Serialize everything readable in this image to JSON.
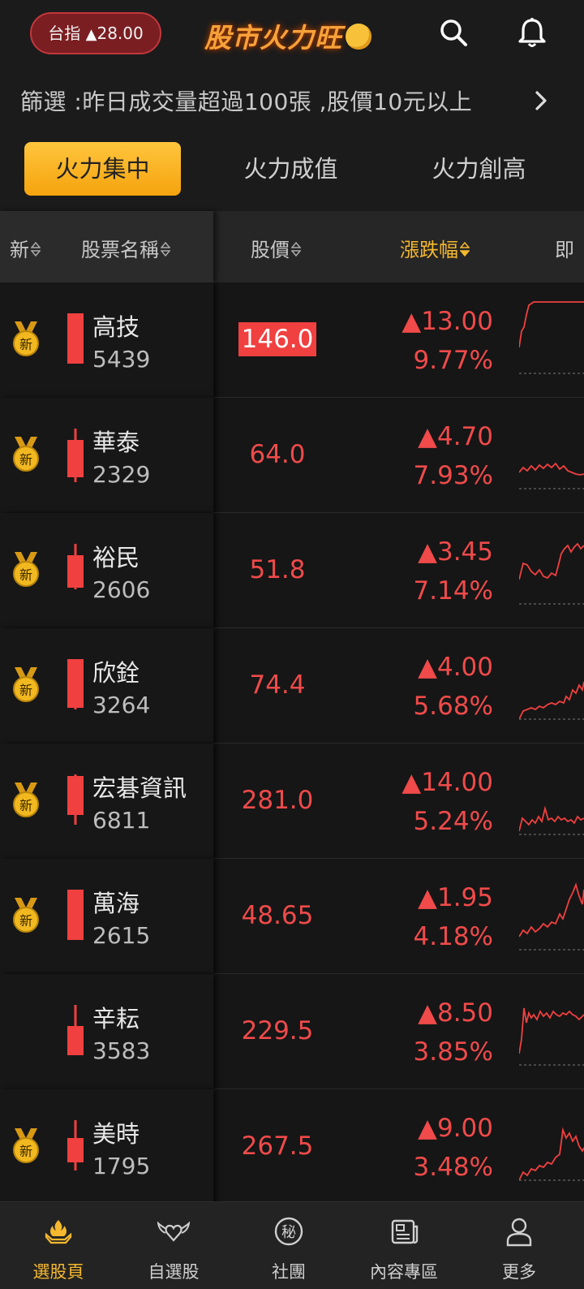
{
  "header": {
    "index_label": "台指",
    "index_arrow": "▲",
    "index_value": "28.00",
    "logo_text": "股市火力旺",
    "icons": [
      "search-icon",
      "bell-icon"
    ]
  },
  "filter": {
    "text": "篩選 :昨日成交量超過100張 ,股價10元以上",
    "icon": "chevron-right-icon"
  },
  "tabs": [
    {
      "label": "火力集中",
      "active": true
    },
    {
      "label": "火力成值",
      "active": false
    },
    {
      "label": "火力創高",
      "active": false
    }
  ],
  "columns": {
    "new": "新",
    "name": "股票名稱",
    "price": "股價",
    "change": "漲跌幅",
    "realtime": "即"
  },
  "rows": [
    {
      "new": true,
      "name": "高技",
      "code": "5439",
      "price": "146.0",
      "highlight": true,
      "change": "▲13.00",
      "pct": "9.77%"
    },
    {
      "new": true,
      "name": "華泰",
      "code": "2329",
      "price": "64.0",
      "highlight": false,
      "change": "▲4.70",
      "pct": "7.93%"
    },
    {
      "new": true,
      "name": "裕民",
      "code": "2606",
      "price": "51.8",
      "highlight": false,
      "change": "▲3.45",
      "pct": "7.14%"
    },
    {
      "new": true,
      "name": "欣銓",
      "code": "3264",
      "price": "74.4",
      "highlight": false,
      "change": "▲4.00",
      "pct": "5.68%"
    },
    {
      "new": true,
      "name": "宏碁資訊",
      "code": "6811",
      "price": "281.0",
      "highlight": false,
      "change": "▲14.00",
      "pct": "5.24%"
    },
    {
      "new": true,
      "name": "萬海",
      "code": "2615",
      "price": "48.65",
      "highlight": false,
      "change": "▲1.95",
      "pct": "4.18%"
    },
    {
      "new": false,
      "name": "辛耘",
      "code": "3583",
      "price": "229.5",
      "highlight": false,
      "change": "▲8.50",
      "pct": "3.85%"
    },
    {
      "new": true,
      "name": "美時",
      "code": "1795",
      "price": "267.5",
      "highlight": false,
      "change": "▲9.00",
      "pct": "3.48%"
    }
  ],
  "new_badge": "新",
  "colors": {
    "up": "#f04a4a",
    "accent": "#f5b82e",
    "bg": "#161616"
  },
  "bottom_nav": [
    {
      "label": "選股頁",
      "icon": "fire-hand-icon",
      "active": true
    },
    {
      "label": "自選股",
      "icon": "winged-heart-icon",
      "active": false
    },
    {
      "label": "社團",
      "icon": "secret-badge-icon",
      "active": false,
      "glyph": "秘"
    },
    {
      "label": "內容專區",
      "icon": "newspaper-icon",
      "active": false
    },
    {
      "label": "更多",
      "icon": "person-icon",
      "active": false
    }
  ]
}
